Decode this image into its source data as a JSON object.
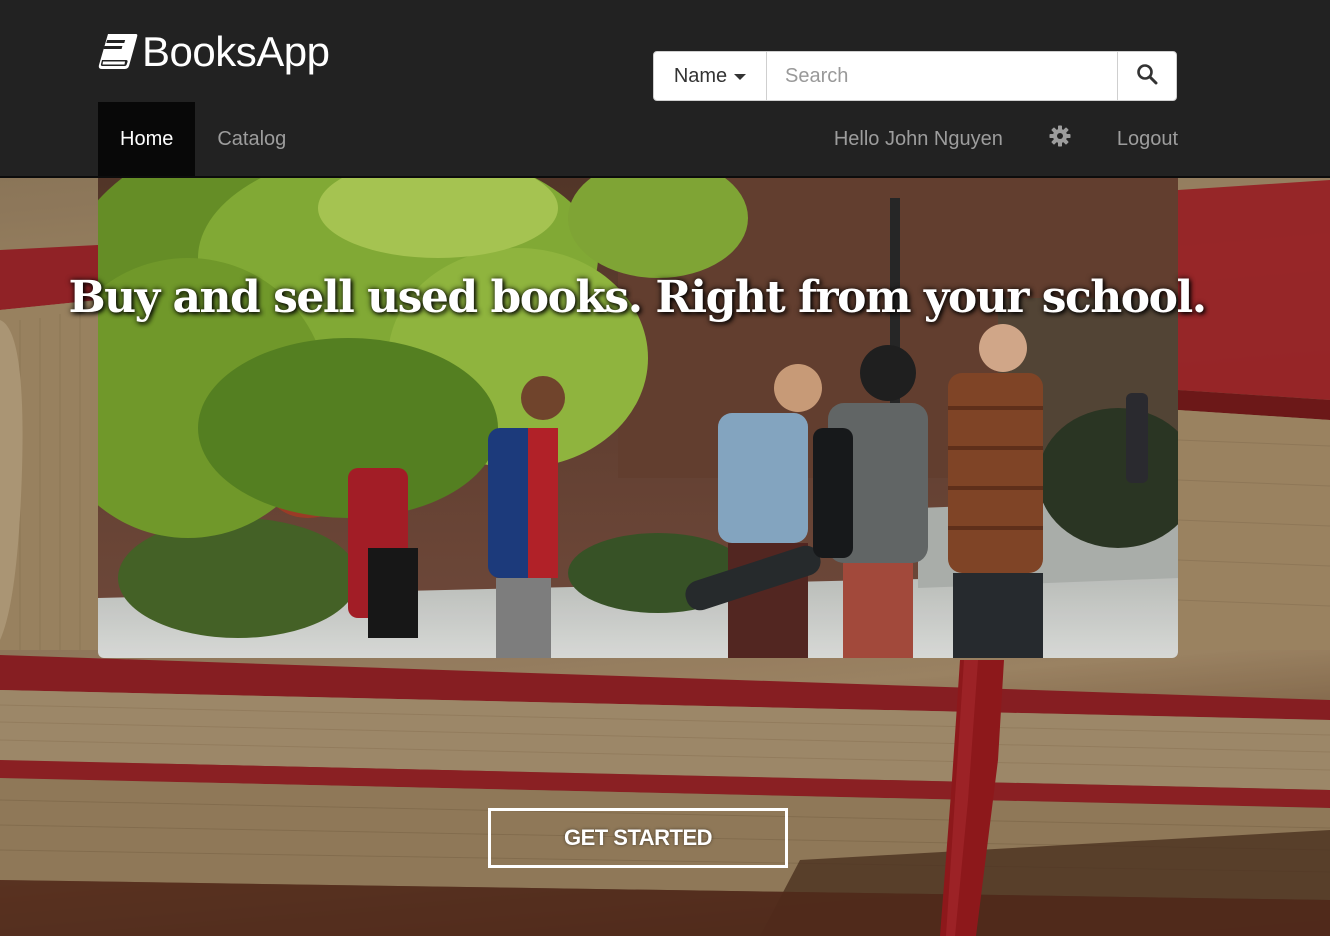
{
  "brand": {
    "name": "BooksApp",
    "icon": "book-icon"
  },
  "search": {
    "type_label": "Name",
    "placeholder": "Search",
    "value": "",
    "button_icon": "search-icon"
  },
  "nav": {
    "items": [
      {
        "label": "Home",
        "active": true
      },
      {
        "label": "Catalog",
        "active": false
      }
    ],
    "greeting": "Hello John Nguyen",
    "settings_icon": "gear-icon",
    "logout_label": "Logout"
  },
  "hero": {
    "headline": "Buy and sell used books. Right from your school."
  },
  "cta": {
    "label": "GET STARTED"
  },
  "colors": {
    "navbar": "#222222",
    "nav_active": "#080808",
    "nav_text": "#9d9d9d"
  }
}
